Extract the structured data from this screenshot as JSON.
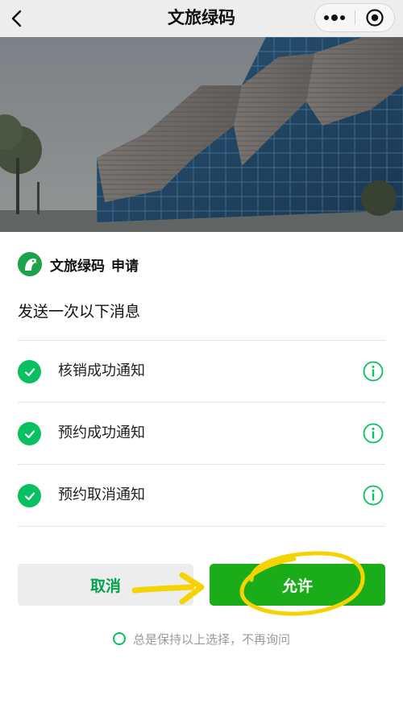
{
  "navbar": {
    "title": "文旅绿码",
    "back_icon": "chevron-left-icon",
    "more_icon": "more-dots-icon",
    "close_icon": "target-close-icon"
  },
  "hero": {
    "description_icon": "building-photo"
  },
  "app": {
    "name": "文旅绿码",
    "request": "申请",
    "logo_icon": "parrot-logo-icon",
    "logo_color": "#1aa34a"
  },
  "prompt": "发送一次以下消息",
  "messages": [
    {
      "label": "核销成功通知",
      "checked": true
    },
    {
      "label": "预约成功通知",
      "checked": true
    },
    {
      "label": "预约取消通知",
      "checked": true
    }
  ],
  "buttons": {
    "cancel": "取消",
    "allow": "允许"
  },
  "remember": {
    "text": "总是保持以上选择，不再询问",
    "checked": false
  },
  "colors": {
    "accent_green": "#07c160",
    "allow_green": "#1aad19",
    "annotation_yellow": "#f5d300"
  }
}
